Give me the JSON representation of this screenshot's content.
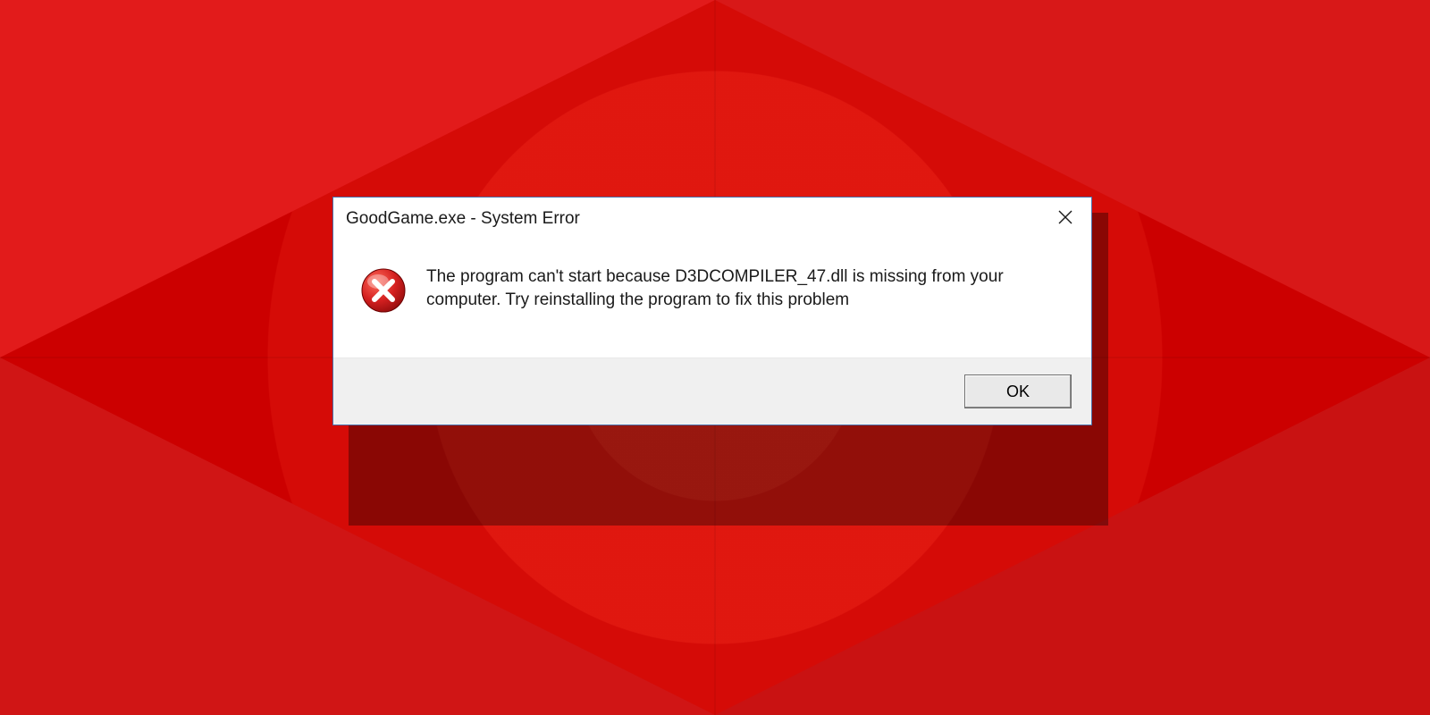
{
  "dialog": {
    "title": "GoodGame.exe - System Error",
    "message": "The program can't start because D3DCOMPILER_47.dll is missing from your computer. Try reinstalling the program to fix this problem",
    "ok_label": "OK",
    "icon": "error-icon"
  }
}
